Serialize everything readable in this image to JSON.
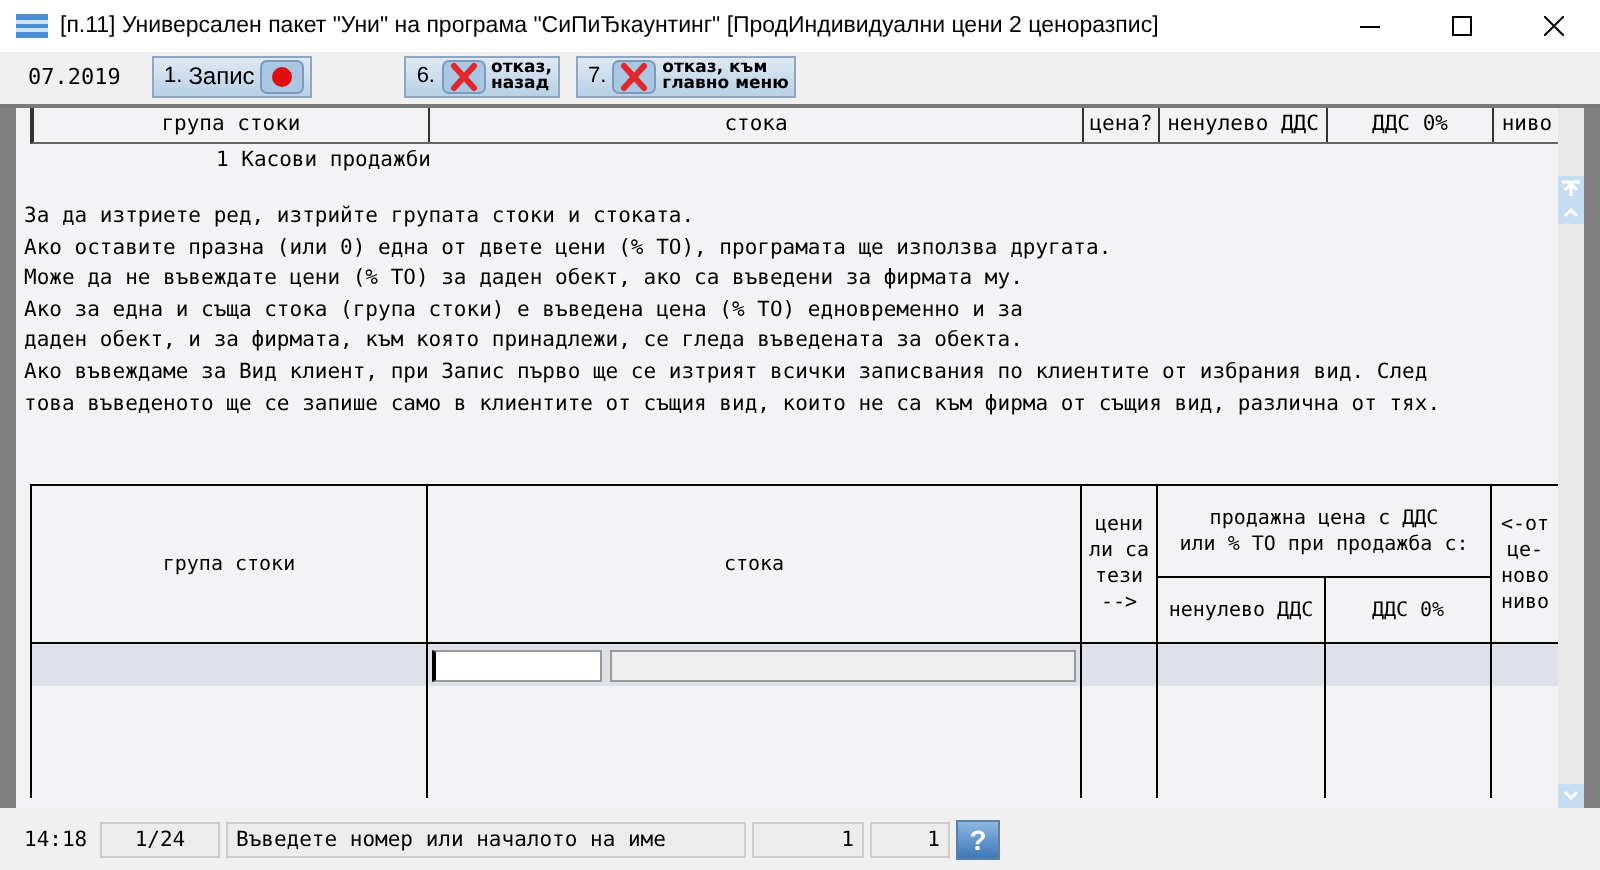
{
  "window": {
    "title": "[п.11] Универсален пакет \"Уни\" на програма \"СиПиЂкаунтинг\" [ПродИндивидуални цени 2 ценоразпис]"
  },
  "toolbar": {
    "period": "07.2019",
    "buttons": [
      {
        "number": "1.",
        "label": "Запис",
        "kind": "record"
      },
      {
        "number": "6.",
        "label": "отказ,\nназад",
        "kind": "cancel"
      },
      {
        "number": "7.",
        "label": "отказ, към\nглавно меню",
        "kind": "cancel"
      }
    ]
  },
  "header_columns": [
    "група стоки",
    "стока",
    "цена?",
    "ненулево ДДС",
    "ДДС 0%",
    "ниво"
  ],
  "group_row": "1 Касови продажби",
  "notes": [
    "За да изтриете ред, изтрийте групата стоки и стоката.",
    "Ако оставите празна (или 0) една от двете цени (% ТО), програмата ще използва другата.",
    "Може да не въвеждате цени (% ТО) за даден обект, ако са въведени за фирмата му.",
    "Ако за една и съща стока (група стоки) е въведена цена (% ТО) едновременно и за",
    "даден обект, и за фирмата, към която принадлежи, се гледа въведената за обекта.",
    "Ако въвеждаме за Вид клиент, при Запис първо ще се изтрият всички записвания по клиентите от избрания вид. След",
    "това въведеното ще се запише само в клиентите от същия вид, които не са към фирма от същия вид, различна от тях."
  ],
  "table": {
    "columns": [
      {
        "label": "група стоки"
      },
      {
        "label": "стока"
      },
      {
        "label": "цени\nли са\nтези\n-->"
      },
      {
        "label": "продажна цена с ДДС\nили % ТО при продажба с:",
        "children": [
          {
            "label": "ненулево ДДС"
          },
          {
            "label": "ДДС 0%"
          }
        ]
      },
      {
        "label": "<-от\nце-\nново\nниво"
      }
    ],
    "edit_row": {
      "selected": true
    }
  },
  "status_bar": {
    "time": "14:18",
    "record": "1/24",
    "message": "Въведете номер или началото на име",
    "field_1": "1",
    "field_2": "1",
    "help": "?"
  }
}
